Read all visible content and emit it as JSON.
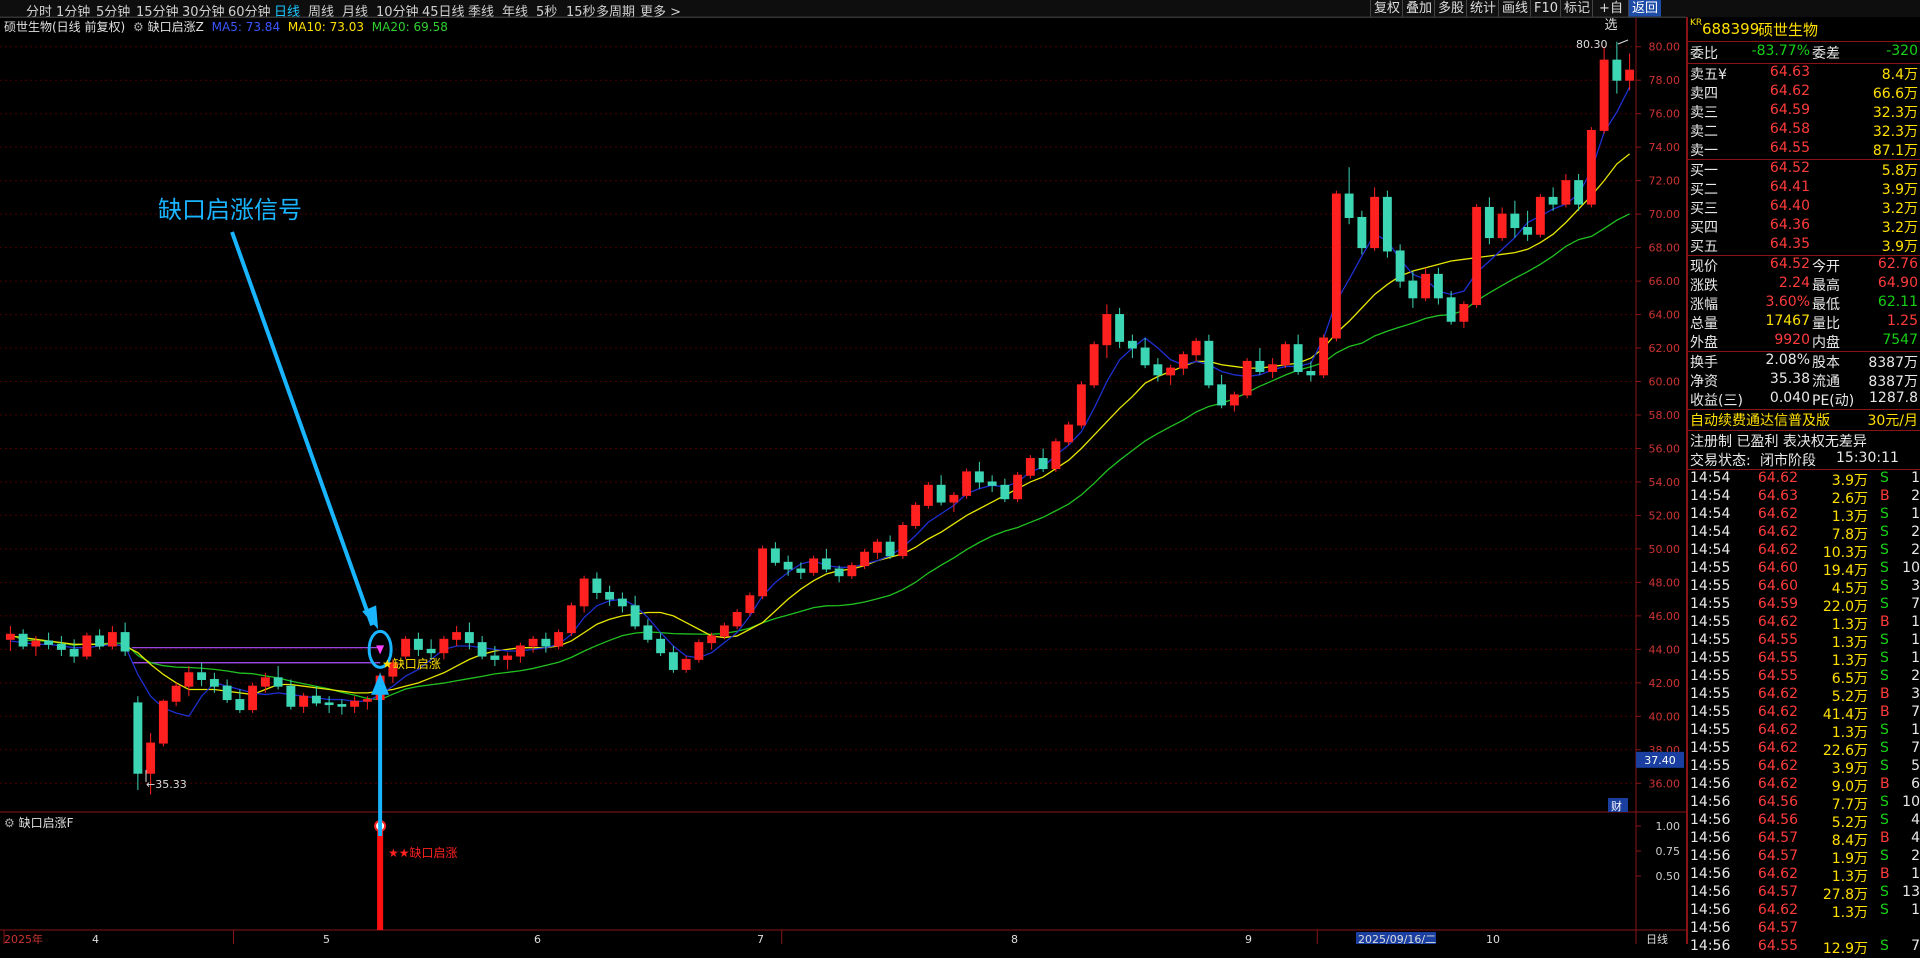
{
  "toolbar": {
    "periods": [
      "分时",
      "1分钟",
      "5分钟",
      "15分钟",
      "30分钟",
      "60分钟",
      "日线",
      "周线",
      "月线",
      "10分钟",
      "45日线",
      "季线",
      "年线",
      "5秒",
      "15秒",
      "多周期",
      "更多"
    ],
    "active_period": "日线",
    "right_buttons": [
      "复权",
      "叠加",
      "多股",
      "统计",
      "画线",
      "F10",
      "标记",
      "+自选",
      "返回"
    ]
  },
  "info": {
    "title": "硕世生物(日线 前复权)",
    "indicator": "缺口启涨Z",
    "ma5": "MA5: 73.84",
    "ma10": "MA10: 73.03",
    "ma20": "MA20: 69.58"
  },
  "sub_panel": {
    "title": "缺口启涨F",
    "signal_label": "★★缺口启涨",
    "ticks": [
      "1.00",
      "0.75",
      "0.50"
    ]
  },
  "annotation": {
    "text": "缺口启涨信号",
    "main_signal": "★缺口启涨"
  },
  "price_axis": [
    "80.00",
    "78.00",
    "76.00",
    "74.00",
    "72.00",
    "70.00",
    "68.00",
    "66.00",
    "64.00",
    "62.00",
    "60.00",
    "58.00",
    "56.00",
    "54.00",
    "52.00",
    "50.00",
    "48.00",
    "46.00",
    "44.00",
    "42.00",
    "40.00",
    "38.00",
    "36.00"
  ],
  "axis_marker": "37.40",
  "high_label": "80.30",
  "low_label": "35.33",
  "date_axis": {
    "labels": [
      "2025年",
      "4",
      "5",
      "6",
      "7",
      "8",
      "9",
      "2025/09/16/二",
      "10"
    ],
    "period": "日线",
    "badge": "财"
  },
  "stock": {
    "prefix": "KR",
    "code": "688399",
    "name": "硕世生物"
  },
  "weibi": {
    "label1": "委比",
    "value1": "-83.77%",
    "label2": "委差",
    "value2": "-320"
  },
  "asks": [
    {
      "label": "卖五¥",
      "price": "64.63",
      "vol": "8.4万"
    },
    {
      "label": "卖四",
      "price": "64.62",
      "vol": "66.6万"
    },
    {
      "label": "卖三",
      "price": "64.59",
      "vol": "32.3万"
    },
    {
      "label": "卖二",
      "price": "64.58",
      "vol": "32.3万"
    },
    {
      "label": "卖一",
      "price": "64.55",
      "vol": "87.1万"
    }
  ],
  "bids": [
    {
      "label": "买一",
      "price": "64.52",
      "vol": "5.8万"
    },
    {
      "label": "买二",
      "price": "64.41",
      "vol": "3.9万"
    },
    {
      "label": "买三",
      "price": "64.40",
      "vol": "3.2万"
    },
    {
      "label": "买四",
      "price": "64.36",
      "vol": "3.2万"
    },
    {
      "label": "买五",
      "price": "64.35",
      "vol": "3.9万"
    }
  ],
  "quote": [
    {
      "l1": "现价",
      "v1": "64.52",
      "c1": "red",
      "l2": "今开",
      "v2": "62.76",
      "c2": "red"
    },
    {
      "l1": "涨跌",
      "v1": "2.24",
      "c1": "red",
      "l2": "最高",
      "v2": "64.90",
      "c2": "red"
    },
    {
      "l1": "涨幅",
      "v1": "3.60%",
      "c1": "red",
      "l2": "最低",
      "v2": "62.11",
      "c2": "green"
    },
    {
      "l1": "总量",
      "v1": "17467",
      "c1": "yellow",
      "l2": "量比",
      "v2": "1.25",
      "c2": "red"
    },
    {
      "l1": "外盘",
      "v1": "9920",
      "c1": "red",
      "l2": "内盘",
      "v2": "7547",
      "c2": "green"
    }
  ],
  "fundamentals": [
    {
      "l1": "换手",
      "v1": "2.08%",
      "l2": "股本",
      "v2": "8387万"
    },
    {
      "l1": "净资",
      "v1": "35.38",
      "l2": "流通",
      "v2": "8387万"
    },
    {
      "l1": "收益(三)",
      "v1": "0.040",
      "l2": "PE(动)",
      "v2": "1287.8"
    }
  ],
  "promo": {
    "text": "自动续费通达信普及版",
    "price": "30元/月"
  },
  "reg": {
    "text": "注册制 已盈利 表决权无差异"
  },
  "status": {
    "label": "交易状态:",
    "value": "闭市阶段",
    "time": "15:30:11"
  },
  "ticks": [
    {
      "t": "14:54",
      "p": "64.62",
      "pc": "red",
      "v": "3.9万",
      "s": "S",
      "n": "1"
    },
    {
      "t": "14:54",
      "p": "64.63",
      "pc": "red",
      "v": "2.6万",
      "s": "B",
      "n": "2"
    },
    {
      "t": "14:54",
      "p": "64.62",
      "pc": "red",
      "v": "1.3万",
      "s": "S",
      "n": "1"
    },
    {
      "t": "14:54",
      "p": "64.62",
      "pc": "red",
      "v": "7.8万",
      "s": "S",
      "n": "2"
    },
    {
      "t": "14:54",
      "p": "64.62",
      "pc": "red",
      "v": "10.3万",
      "s": "S",
      "n": "2"
    },
    {
      "t": "14:55",
      "p": "64.60",
      "pc": "red",
      "v": "19.4万",
      "s": "S",
      "n": "10"
    },
    {
      "t": "14:55",
      "p": "64.60",
      "pc": "red",
      "v": "4.5万",
      "s": "S",
      "n": "3"
    },
    {
      "t": "14:55",
      "p": "64.59",
      "pc": "red",
      "v": "22.0万",
      "s": "S",
      "n": "7"
    },
    {
      "t": "14:55",
      "p": "64.62",
      "pc": "red",
      "v": "1.3万",
      "s": "B",
      "n": "1"
    },
    {
      "t": "14:55",
      "p": "64.55",
      "pc": "red",
      "v": "1.3万",
      "s": "S",
      "n": "1"
    },
    {
      "t": "14:55",
      "p": "64.55",
      "pc": "red",
      "v": "1.3万",
      "s": "S",
      "n": "1"
    },
    {
      "t": "14:55",
      "p": "64.55",
      "pc": "red",
      "v": "6.5万",
      "s": "S",
      "n": "2"
    },
    {
      "t": "14:55",
      "p": "64.62",
      "pc": "red",
      "v": "5.2万",
      "s": "B",
      "n": "3"
    },
    {
      "t": "14:55",
      "p": "64.62",
      "pc": "red",
      "v": "41.4万",
      "s": "B",
      "n": "7"
    },
    {
      "t": "14:55",
      "p": "64.62",
      "pc": "red",
      "v": "1.3万",
      "s": "S",
      "n": "1"
    },
    {
      "t": "14:55",
      "p": "64.62",
      "pc": "red",
      "v": "22.6万",
      "s": "S",
      "n": "7"
    },
    {
      "t": "14:55",
      "p": "64.62",
      "pc": "red",
      "v": "3.9万",
      "s": "S",
      "n": "5"
    },
    {
      "t": "14:56",
      "p": "64.62",
      "pc": "red",
      "v": "9.0万",
      "s": "B",
      "n": "6"
    },
    {
      "t": "14:56",
      "p": "64.56",
      "pc": "red",
      "v": "7.7万",
      "s": "S",
      "n": "10"
    },
    {
      "t": "14:56",
      "p": "64.56",
      "pc": "red",
      "v": "5.2万",
      "s": "S",
      "n": "4"
    },
    {
      "t": "14:56",
      "p": "64.57",
      "pc": "red",
      "v": "8.4万",
      "s": "B",
      "n": "4"
    },
    {
      "t": "14:56",
      "p": "64.57",
      "pc": "red",
      "v": "1.9万",
      "s": "S",
      "n": "2"
    },
    {
      "t": "14:56",
      "p": "64.62",
      "pc": "red",
      "v": "1.3万",
      "s": "B",
      "n": "1"
    },
    {
      "t": "14:56",
      "p": "64.57",
      "pc": "red",
      "v": "27.8万",
      "s": "S",
      "n": "13"
    },
    {
      "t": "14:56",
      "p": "64.62",
      "pc": "red",
      "v": "1.3万",
      "s": "S",
      "n": "1"
    },
    {
      "t": "14:56",
      "p": "64.57",
      "pc": "red",
      "v": "",
      "s": "",
      "n": ""
    },
    {
      "t": "14:56",
      "p": "64.55",
      "pc": "red",
      "v": "12.9万",
      "s": "S",
      "n": "7"
    }
  ],
  "colors": {
    "up": "#ff2020",
    "down": "#3dd6b5",
    "ma5": "#1e2fd0",
    "ma10": "#e6e600",
    "ma20": "#20c020",
    "accent": "#19c7ff",
    "grid": "#4a0000"
  },
  "chart_data": {
    "type": "candlestick",
    "ylim": [
      35,
      81
    ],
    "candles": [
      [
        44.6,
        45.4,
        43.9,
        44.9
      ],
      [
        44.9,
        45.2,
        44.0,
        44.2
      ],
      [
        44.2,
        44.8,
        43.6,
        44.5
      ],
      [
        44.5,
        45.0,
        44.0,
        44.3
      ],
      [
        44.3,
        44.8,
        43.6,
        44.0
      ],
      [
        44.0,
        44.6,
        43.2,
        43.6
      ],
      [
        43.6,
        45.0,
        43.4,
        44.8
      ],
      [
        44.8,
        45.2,
        44.0,
        44.2
      ],
      [
        44.2,
        45.4,
        44.0,
        45.0
      ],
      [
        45.0,
        45.6,
        43.6,
        43.9
      ],
      [
        40.8,
        41.2,
        35.6,
        36.6
      ],
      [
        36.6,
        39.0,
        35.33,
        38.4
      ],
      [
        38.4,
        41.0,
        38.2,
        40.9
      ],
      [
        40.9,
        42.0,
        40.6,
        41.8
      ],
      [
        41.8,
        43.0,
        41.2,
        42.6
      ],
      [
        42.6,
        43.2,
        41.8,
        42.2
      ],
      [
        42.2,
        42.6,
        41.4,
        41.8
      ],
      [
        41.8,
        42.2,
        40.8,
        41.0
      ],
      [
        41.0,
        41.6,
        40.2,
        40.4
      ],
      [
        40.4,
        42.0,
        40.2,
        41.8
      ],
      [
        41.8,
        42.6,
        41.4,
        42.3
      ],
      [
        42.3,
        43.0,
        41.6,
        41.8
      ],
      [
        41.8,
        42.2,
        40.4,
        40.6
      ],
      [
        40.6,
        41.4,
        40.2,
        41.2
      ],
      [
        41.2,
        41.8,
        40.6,
        40.8
      ],
      [
        40.8,
        41.2,
        40.2,
        40.7
      ],
      [
        40.7,
        41.0,
        40.1,
        40.6
      ],
      [
        40.6,
        41.2,
        40.2,
        40.9
      ],
      [
        40.9,
        41.2,
        40.4,
        41.0
      ],
      [
        41.0,
        42.6,
        40.8,
        42.4
      ],
      [
        42.4,
        43.4,
        42.0,
        43.2
      ],
      [
        43.6,
        44.8,
        43.4,
        44.6
      ],
      [
        44.6,
        45.0,
        43.6,
        44.0
      ],
      [
        44.0,
        44.6,
        43.4,
        43.8
      ],
      [
        43.8,
        44.8,
        43.4,
        44.6
      ],
      [
        44.6,
        45.4,
        44.2,
        45.0
      ],
      [
        45.0,
        45.6,
        44.0,
        44.4
      ],
      [
        44.4,
        44.8,
        43.4,
        43.6
      ],
      [
        43.6,
        44.2,
        43.0,
        43.4
      ],
      [
        43.4,
        43.8,
        42.8,
        43.6
      ],
      [
        43.6,
        44.4,
        43.2,
        44.2
      ],
      [
        44.2,
        44.8,
        43.8,
        44.6
      ],
      [
        44.6,
        45.0,
        43.8,
        44.2
      ],
      [
        44.2,
        45.2,
        44.0,
        45.0
      ],
      [
        45.0,
        46.8,
        44.8,
        46.6
      ],
      [
        46.6,
        48.4,
        46.2,
        48.2
      ],
      [
        48.2,
        48.6,
        47.0,
        47.4
      ],
      [
        47.4,
        47.8,
        46.6,
        47.0
      ],
      [
        47.0,
        47.4,
        46.2,
        46.6
      ],
      [
        46.6,
        47.2,
        45.2,
        45.4
      ],
      [
        45.4,
        45.8,
        44.4,
        44.6
      ],
      [
        44.6,
        45.0,
        43.6,
        43.8
      ],
      [
        43.8,
        44.2,
        42.6,
        42.8
      ],
      [
        42.8,
        43.6,
        42.6,
        43.4
      ],
      [
        43.4,
        44.6,
        43.2,
        44.4
      ],
      [
        44.4,
        45.0,
        44.0,
        44.8
      ],
      [
        44.8,
        45.6,
        44.6,
        45.4
      ],
      [
        45.4,
        46.4,
        45.2,
        46.2
      ],
      [
        46.2,
        47.4,
        46.0,
        47.2
      ],
      [
        47.2,
        50.2,
        47.0,
        50.0
      ],
      [
        50.0,
        50.4,
        49.0,
        49.2
      ],
      [
        49.2,
        49.6,
        48.4,
        48.8
      ],
      [
        48.8,
        49.2,
        48.2,
        48.6
      ],
      [
        48.6,
        49.6,
        48.4,
        49.4
      ],
      [
        49.4,
        50.0,
        48.6,
        48.8
      ],
      [
        48.8,
        49.0,
        48.0,
        48.4
      ],
      [
        48.4,
        49.2,
        48.2,
        49.0
      ],
      [
        49.0,
        50.0,
        48.8,
        49.8
      ],
      [
        49.8,
        50.6,
        49.4,
        50.4
      ],
      [
        50.4,
        50.8,
        49.4,
        49.6
      ],
      [
        49.6,
        51.6,
        49.4,
        51.4
      ],
      [
        51.4,
        52.8,
        51.2,
        52.6
      ],
      [
        52.6,
        54.0,
        52.4,
        53.8
      ],
      [
        53.8,
        54.4,
        52.6,
        52.8
      ],
      [
        52.8,
        53.4,
        52.2,
        53.2
      ],
      [
        53.2,
        54.8,
        53.0,
        54.6
      ],
      [
        54.6,
        55.2,
        53.6,
        54.0
      ],
      [
        54.0,
        54.4,
        53.4,
        53.8
      ],
      [
        53.8,
        54.2,
        52.8,
        53.0
      ],
      [
        53.0,
        54.6,
        52.8,
        54.4
      ],
      [
        54.4,
        55.6,
        54.2,
        55.4
      ],
      [
        55.4,
        56.0,
        54.6,
        54.8
      ],
      [
        54.8,
        56.6,
        54.6,
        56.4
      ],
      [
        56.4,
        57.6,
        56.2,
        57.4
      ],
      [
        57.4,
        60.0,
        57.2,
        59.8
      ],
      [
        59.8,
        62.4,
        59.6,
        62.2
      ],
      [
        62.2,
        64.6,
        61.4,
        64.0
      ],
      [
        64.0,
        64.4,
        62.0,
        62.4
      ],
      [
        62.4,
        62.8,
        61.4,
        62.0
      ],
      [
        62.0,
        62.6,
        60.8,
        61.0
      ],
      [
        61.0,
        61.4,
        60.0,
        60.4
      ],
      [
        60.4,
        61.0,
        59.8,
        60.8
      ],
      [
        60.8,
        61.8,
        60.4,
        61.6
      ],
      [
        61.6,
        62.6,
        61.2,
        62.4
      ],
      [
        62.4,
        62.8,
        59.6,
        59.8
      ],
      [
        59.8,
        60.4,
        58.4,
        58.6
      ],
      [
        58.6,
        59.4,
        58.2,
        59.2
      ],
      [
        59.2,
        61.4,
        59.0,
        61.2
      ],
      [
        61.2,
        62.0,
        60.4,
        60.6
      ],
      [
        60.6,
        61.4,
        60.2,
        61.0
      ],
      [
        61.0,
        62.4,
        60.8,
        62.2
      ],
      [
        62.2,
        62.8,
        60.4,
        60.6
      ],
      [
        60.6,
        61.2,
        60.0,
        60.4
      ],
      [
        60.4,
        62.8,
        60.2,
        62.6
      ],
      [
        62.6,
        71.4,
        62.4,
        71.2
      ],
      [
        71.2,
        72.8,
        69.4,
        69.8
      ],
      [
        69.8,
        70.2,
        67.6,
        68.0
      ],
      [
        68.0,
        71.6,
        67.8,
        71.0
      ],
      [
        71.0,
        71.4,
        67.4,
        67.8
      ],
      [
        67.8,
        68.2,
        65.6,
        66.0
      ],
      [
        66.0,
        66.6,
        64.4,
        65.0
      ],
      [
        65.0,
        66.8,
        64.8,
        66.4
      ],
      [
        66.4,
        66.8,
        64.6,
        65.0
      ],
      [
        65.0,
        65.4,
        63.4,
        63.6
      ],
      [
        63.6,
        64.8,
        63.2,
        64.6
      ],
      [
        64.6,
        70.6,
        64.4,
        70.4
      ],
      [
        70.4,
        71.0,
        68.2,
        68.6
      ],
      [
        68.6,
        70.4,
        68.4,
        70.0
      ],
      [
        70.0,
        70.8,
        68.6,
        69.2
      ],
      [
        69.2,
        70.2,
        68.4,
        68.8
      ],
      [
        68.8,
        71.2,
        68.6,
        71.0
      ],
      [
        71.0,
        71.6,
        70.2,
        70.6
      ],
      [
        70.6,
        72.4,
        70.4,
        72.0
      ],
      [
        72.0,
        72.4,
        70.2,
        70.6
      ],
      [
        70.6,
        75.2,
        70.4,
        75.0
      ],
      [
        75.0,
        80.0,
        74.8,
        79.2
      ],
      [
        79.2,
        80.3,
        77.2,
        78.0
      ],
      [
        78.0,
        79.6,
        77.4,
        78.6
      ]
    ],
    "ma5": [
      44.5,
      44.4,
      44.3,
      44.3,
      44.2,
      44.1,
      44.1,
      44.2,
      44.3,
      44.2,
      42.5,
      41.2,
      40.5,
      40.2,
      40.0,
      41.2,
      42.0,
      41.8,
      41.6,
      41.4,
      41.3,
      41.4,
      41.3,
      41.2,
      41.1,
      41.0,
      41.0,
      40.9,
      40.9,
      41.3,
      41.8,
      42.4,
      42.8,
      43.4,
      44.0,
      44.2,
      44.2,
      44.1,
      44.0,
      43.9,
      43.9,
      44.0,
      44.1,
      44.3,
      44.9,
      45.9,
      46.6,
      46.9,
      47.0,
      46.6,
      45.9,
      45.0,
      44.2,
      43.6,
      43.5,
      43.8,
      44.4,
      45.0,
      46.0,
      47.2,
      48.0,
      48.6,
      49.1,
      49.3,
      49.0,
      48.9,
      48.9,
      49.1,
      49.3,
      49.6,
      50.1,
      50.8,
      51.6,
      52.1,
      52.6,
      53.3,
      53.6,
      53.8,
      53.7,
      54.0,
      54.6,
      54.9,
      55.6,
      56.2,
      57.0,
      58.4,
      60.0,
      61.3,
      62.0,
      62.6,
      62.0,
      61.3,
      61.0,
      61.2,
      61.0,
      60.6,
      60.4,
      60.3,
      60.4,
      60.7,
      60.9,
      60.9,
      61.1,
      62.6,
      64.8,
      66.1,
      67.5,
      68.8,
      68.4,
      67.3,
      66.4,
      66.1,
      65.4,
      65.2,
      65.4,
      66.5,
      67.2,
      67.9,
      68.6,
      69.5,
      69.9,
      70.3,
      70.6,
      71.2,
      72.6,
      74.9,
      76.1,
      77.6
    ],
    "ma10": [
      44.8,
      44.7,
      44.6,
      44.5,
      44.4,
      44.3,
      44.3,
      44.3,
      44.3,
      44.2,
      43.8,
      43.1,
      42.5,
      42.0,
      41.6,
      41.6,
      41.6,
      41.5,
      41.4,
      41.3,
      41.6,
      41.9,
      41.9,
      41.8,
      41.7,
      41.6,
      41.5,
      41.4,
      41.4,
      41.5,
      41.6,
      41.8,
      42.0,
      42.3,
      42.6,
      43.0,
      43.4,
      43.7,
      43.9,
      44.0,
      44.1,
      44.1,
      44.1,
      44.2,
      44.5,
      45.0,
      45.5,
      45.8,
      46.0,
      46.1,
      46.2,
      46.2,
      46.0,
      45.6,
      45.2,
      44.8,
      44.7,
      44.8,
      45.2,
      45.6,
      46.3,
      47.0,
      47.6,
      48.1,
      48.5,
      48.7,
      48.8,
      49.0,
      49.3,
      49.5,
      49.7,
      50.1,
      50.6,
      51.0,
      51.5,
      52.0,
      52.4,
      52.8,
      53.2,
      53.6,
      54.0,
      54.3,
      54.8,
      55.3,
      56.0,
      56.8,
      57.6,
      58.4,
      59.1,
      59.9,
      60.3,
      60.6,
      60.9,
      61.2,
      61.2,
      61.0,
      60.9,
      60.8,
      60.8,
      60.9,
      61.0,
      61.1,
      61.4,
      62.0,
      62.9,
      63.6,
      64.4,
      65.2,
      65.8,
      66.3,
      66.6,
      66.8,
      67.0,
      67.2,
      67.3,
      67.4,
      67.5,
      67.6,
      67.7,
      67.9,
      68.3,
      68.8,
      69.5,
      70.3,
      71.1,
      72.0,
      73.0,
      73.6
    ]
  }
}
